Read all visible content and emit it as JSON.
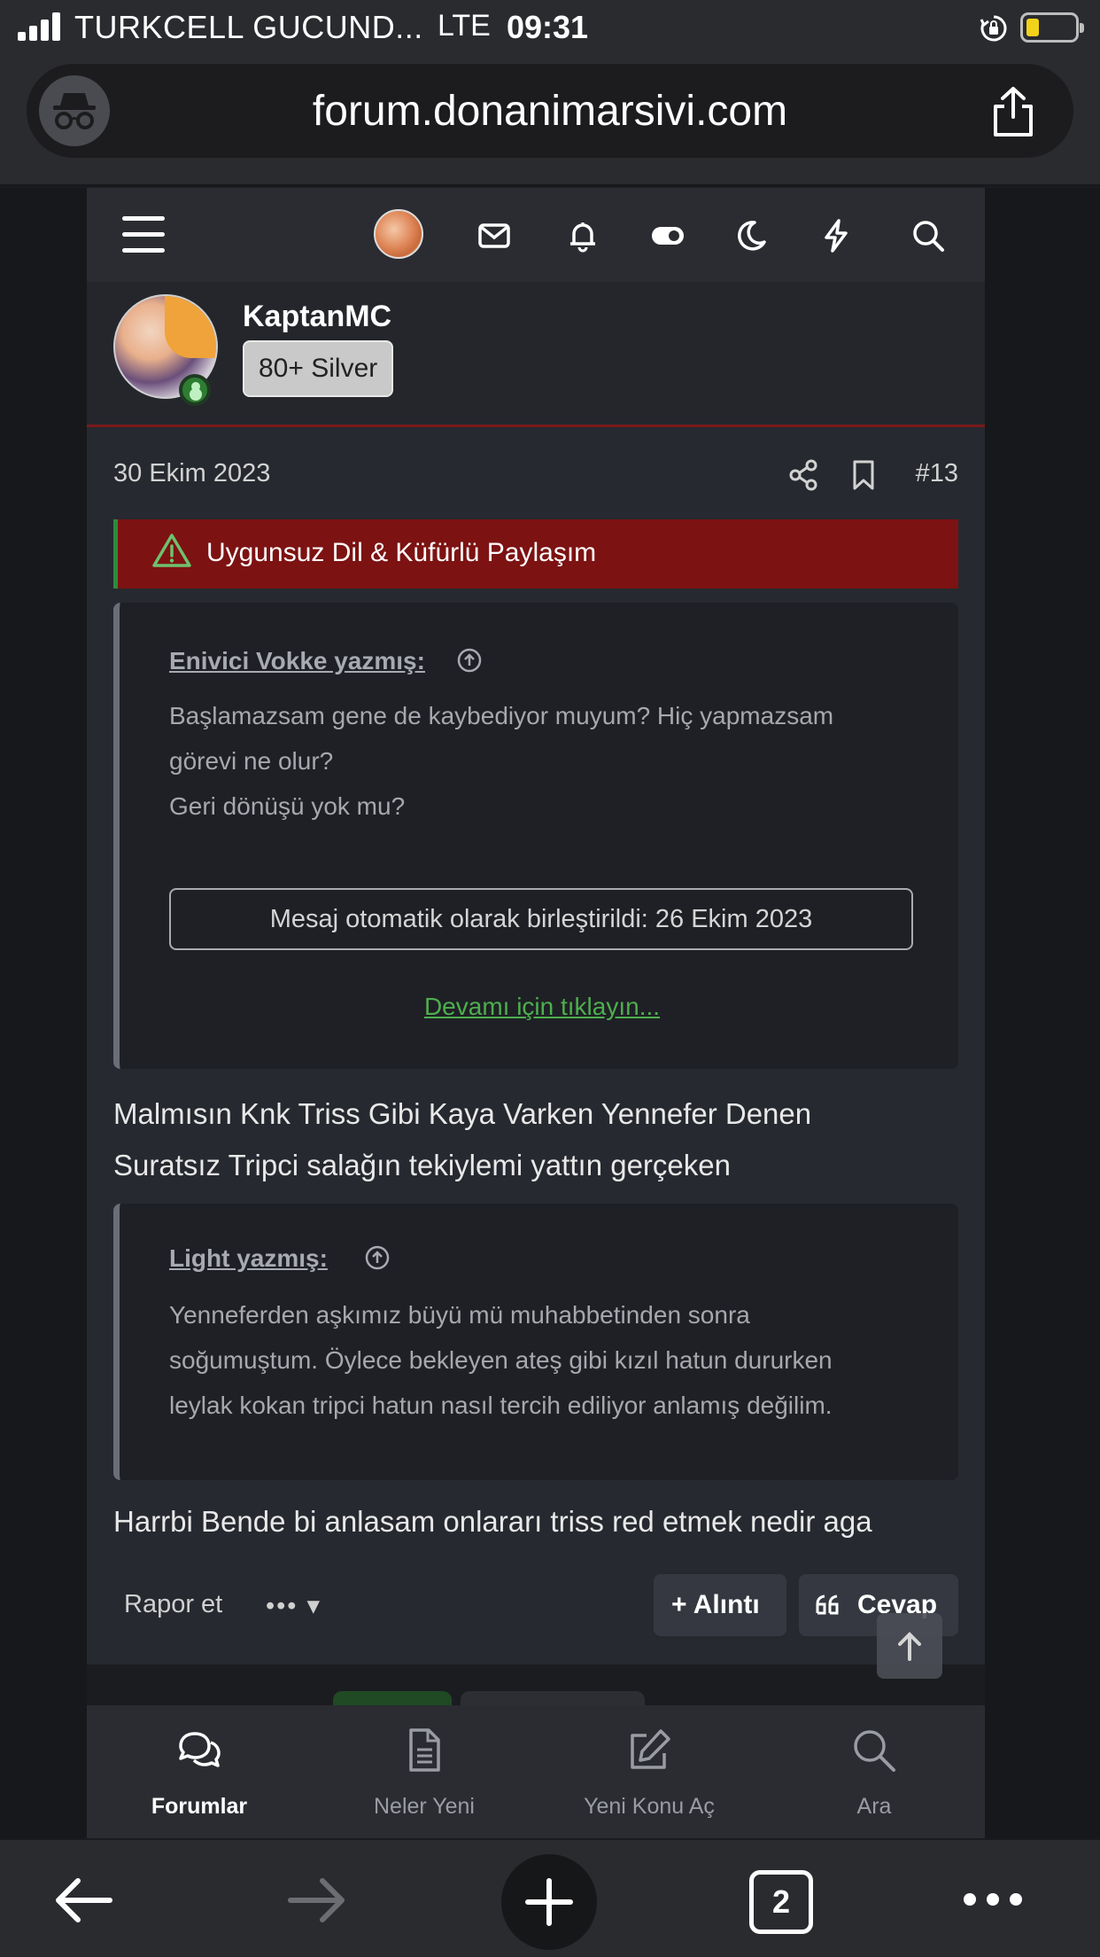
{
  "status_bar": {
    "carrier": "TURKCELL GUCUND...",
    "network": "LTE",
    "time": "09:31"
  },
  "browser": {
    "url": "forum.donanimarsivi.com",
    "open_tabs": "2"
  },
  "forum_nav": {
    "icons": [
      "menu-icon",
      "avatar",
      "mail-icon",
      "bell-icon",
      "toggle-icon",
      "moon-icon",
      "lightning-icon",
      "search-icon"
    ]
  },
  "post": {
    "author": "KaptanMC",
    "badge": "80+ Silver",
    "date": "30 Ekim 2023",
    "number": "#13",
    "warning": "Uygunsuz Dil & Küfürlü Paylaşım",
    "quote1": {
      "author": "Enivici Vokke yazmış:",
      "line1": "Başlamazsam gene de kaybediyor muyum? Hiç yapmazsam",
      "line2": "görevi ne olur?",
      "line3": "Geri dönüşü yok mu?",
      "merged": "Mesaj otomatik olarak birleştirildi: 26 Ekim 2023",
      "expand": "Devamı için tıklayın..."
    },
    "reply1_line1": "Malmısın Knk Triss Gibi Kaya Varken Yennefer Denen",
    "reply1_line2": "Suratsız Tripci salağın tekiylemi yattın gerçeken",
    "quote2": {
      "author": "Light yazmış:",
      "line1": "Yenneferden aşkımız büyü mü muhabbetinden sonra",
      "line2": "soğumuştum. Öylece bekleyen ateş gibi kızıl hatun dururken",
      "line3": "leylak kokan tripci hatun nasıl tercih ediliyor anlamış değilim."
    },
    "reply2": "Harrbi Bende bi anlasam onlararı triss red etmek nedir aga",
    "actions": {
      "report": "Rapor et",
      "more": "••• ▾",
      "quote": "+ Alıntı",
      "reply": "Cevap"
    }
  },
  "bottom_nav": [
    {
      "label": "Forumlar",
      "icon": "forums-icon",
      "active": true
    },
    {
      "label": "Neler Yeni",
      "icon": "document-icon",
      "active": false
    },
    {
      "label": "Yeni Konu Aç",
      "icon": "edit-icon",
      "active": false
    },
    {
      "label": "Ara",
      "icon": "search-icon",
      "active": false
    }
  ],
  "colors": {
    "warning_bg": "#7d1212",
    "link_green": "#4eae4f",
    "online_green": "#2e7d32"
  }
}
